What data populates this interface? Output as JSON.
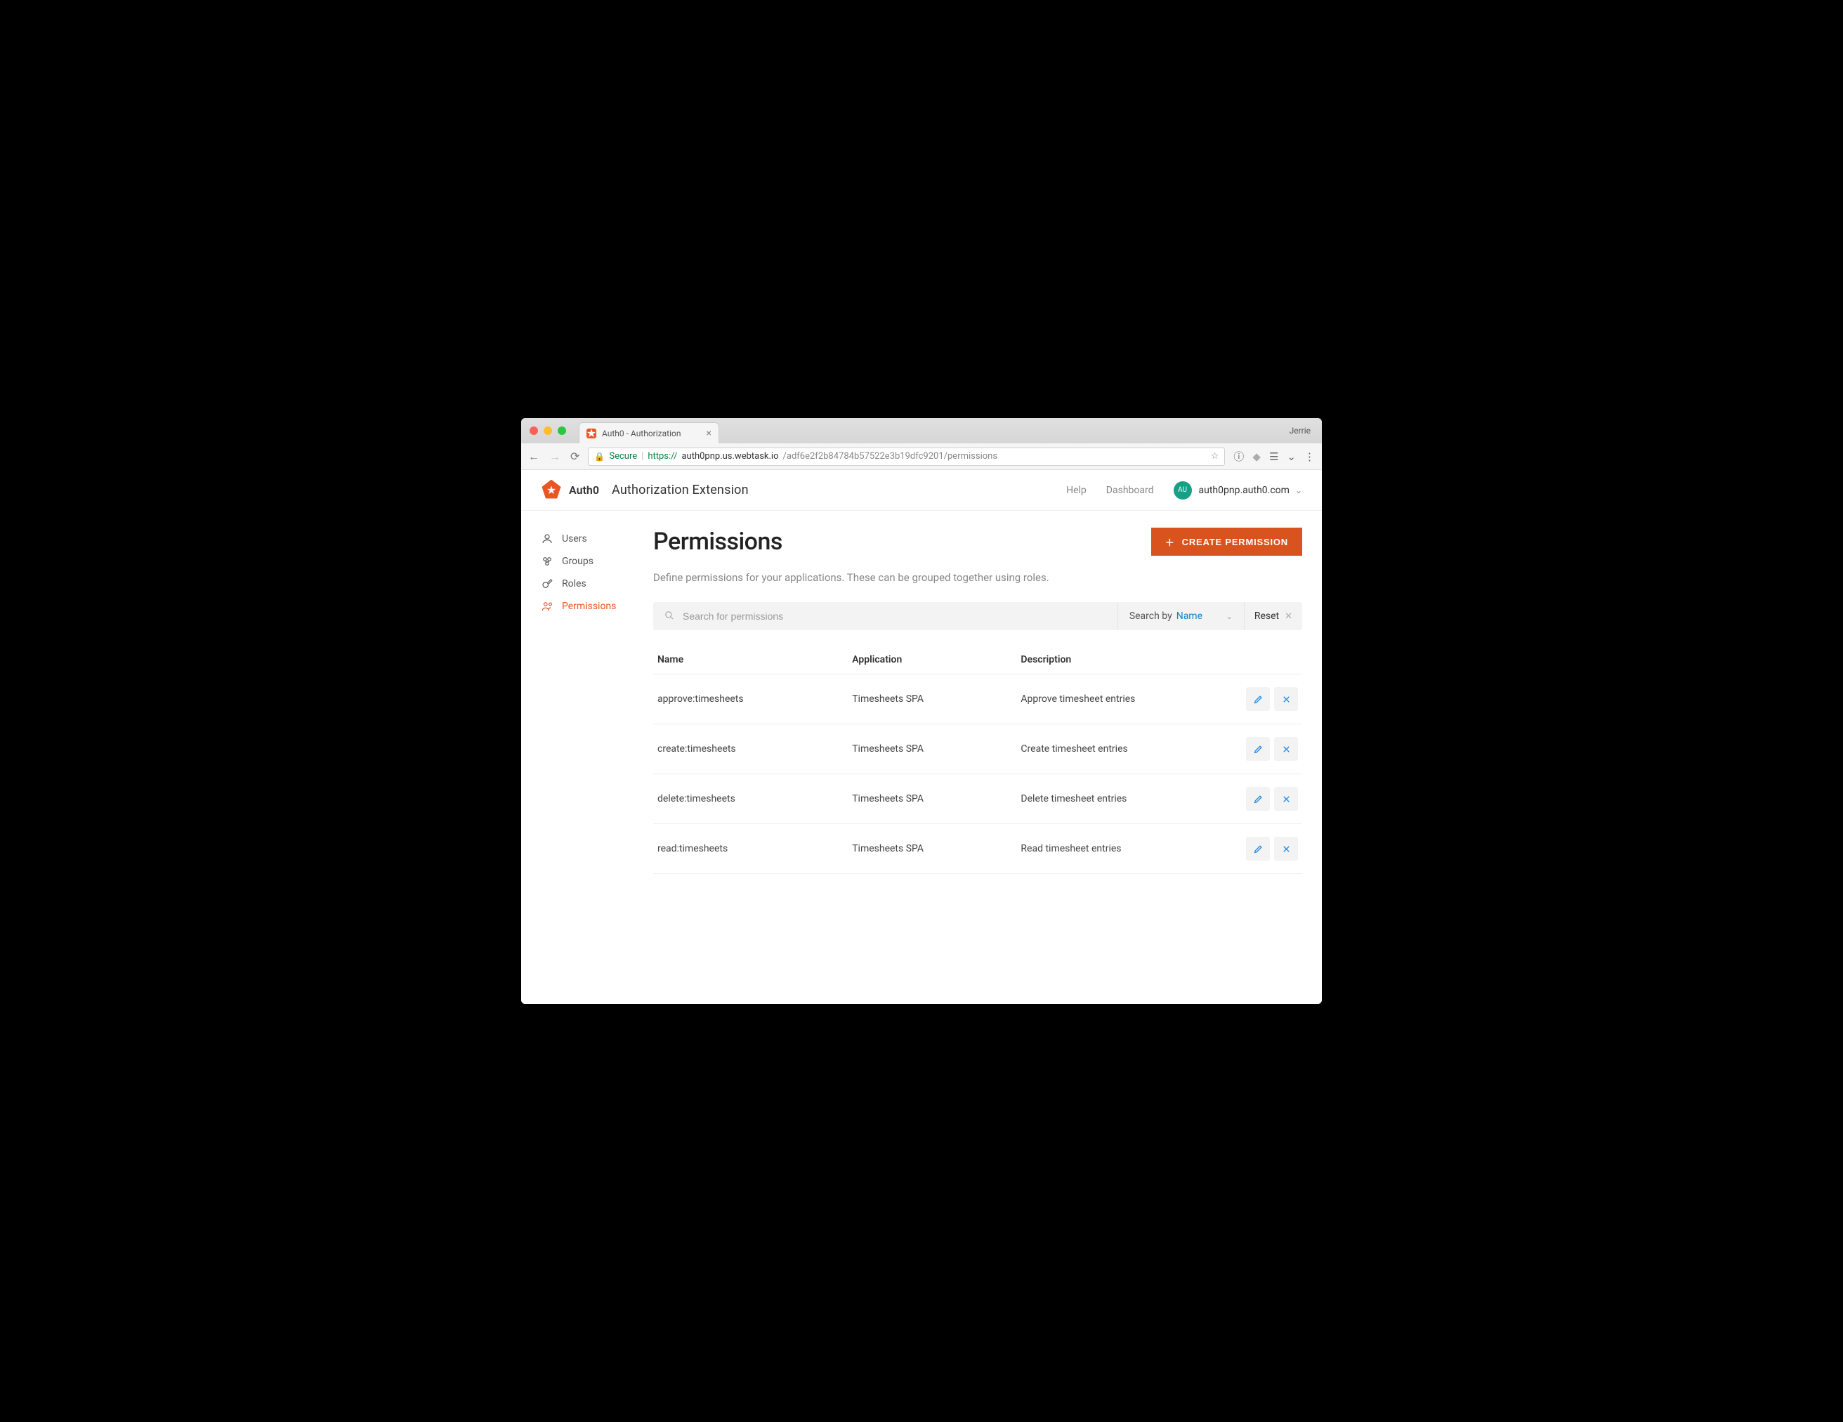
{
  "browser": {
    "tab_title": "Auth0 - Authorization",
    "profile": "Jerrie",
    "secure_label": "Secure",
    "url_scheme": "https://",
    "url_host": "auth0pnp.us.webtask.io",
    "url_path": "/adf6e2f2b84784b57522e3b19dfc9201/permissions"
  },
  "header": {
    "brand": "Auth0",
    "title": "Authorization Extension",
    "help": "Help",
    "dashboard": "Dashboard",
    "tenant_badge": "AU",
    "tenant": "auth0pnp.auth0.com"
  },
  "sidebar": {
    "items": [
      {
        "label": "Users"
      },
      {
        "label": "Groups"
      },
      {
        "label": "Roles"
      },
      {
        "label": "Permissions"
      }
    ]
  },
  "page": {
    "title": "Permissions",
    "create_label": "CREATE PERMISSION",
    "subtitle": "Define permissions for your applications. These can be grouped together using roles."
  },
  "search": {
    "placeholder": "Search for permissions",
    "by_label": "Search by",
    "by_value": "Name",
    "reset": "Reset"
  },
  "table": {
    "cols": {
      "name": "Name",
      "app": "Application",
      "desc": "Description"
    },
    "rows": [
      {
        "name": "approve:timesheets",
        "app": "Timesheets SPA",
        "desc": "Approve timesheet entries"
      },
      {
        "name": "create:timesheets",
        "app": "Timesheets SPA",
        "desc": "Create timesheet entries"
      },
      {
        "name": "delete:timesheets",
        "app": "Timesheets SPA",
        "desc": "Delete timesheet entries"
      },
      {
        "name": "read:timesheets",
        "app": "Timesheets SPA",
        "desc": "Read timesheet entries"
      }
    ]
  }
}
